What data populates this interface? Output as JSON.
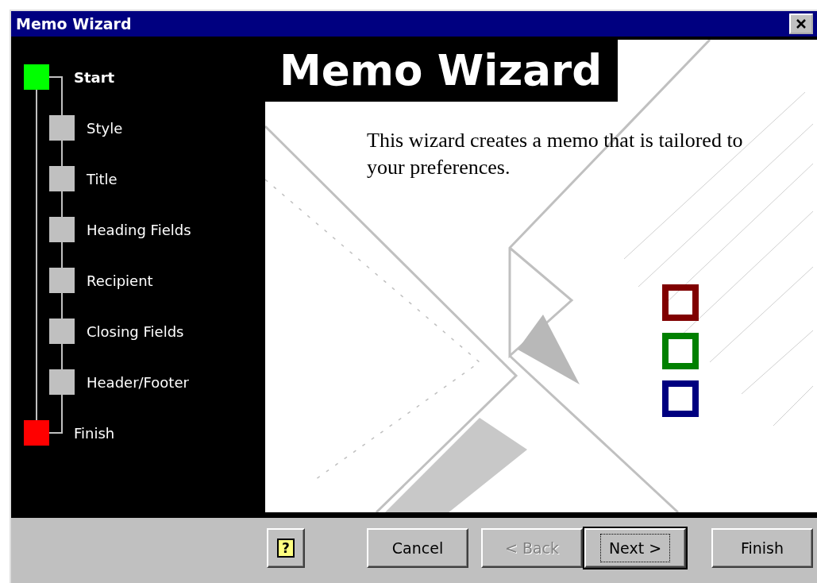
{
  "window": {
    "title": "Memo Wizard"
  },
  "steps": [
    {
      "label": "Start",
      "kind": "start",
      "selected": true
    },
    {
      "label": "Style",
      "kind": "step",
      "selected": false
    },
    {
      "label": "Title",
      "kind": "step",
      "selected": false
    },
    {
      "label": "Heading Fields",
      "kind": "step",
      "selected": false
    },
    {
      "label": "Recipient",
      "kind": "step",
      "selected": false
    },
    {
      "label": "Closing Fields",
      "kind": "step",
      "selected": false
    },
    {
      "label": "Header/Footer",
      "kind": "step",
      "selected": false
    },
    {
      "label": "Finish",
      "kind": "finish",
      "selected": false
    }
  ],
  "header": "Memo Wizard",
  "description": "This wizard creates a memo that is tailored to your preferences.",
  "buttons": [
    {
      "kind": "help",
      "label": "?",
      "disabled": false,
      "default": false
    },
    {
      "kind": "text",
      "label": "Cancel",
      "disabled": false,
      "default": false
    },
    {
      "kind": "text",
      "label": "< Back",
      "disabled": true,
      "default": false
    },
    {
      "kind": "text",
      "label": "Next >",
      "disabled": false,
      "default": true
    },
    {
      "kind": "text",
      "label": "Finish",
      "disabled": false,
      "default": false
    }
  ]
}
